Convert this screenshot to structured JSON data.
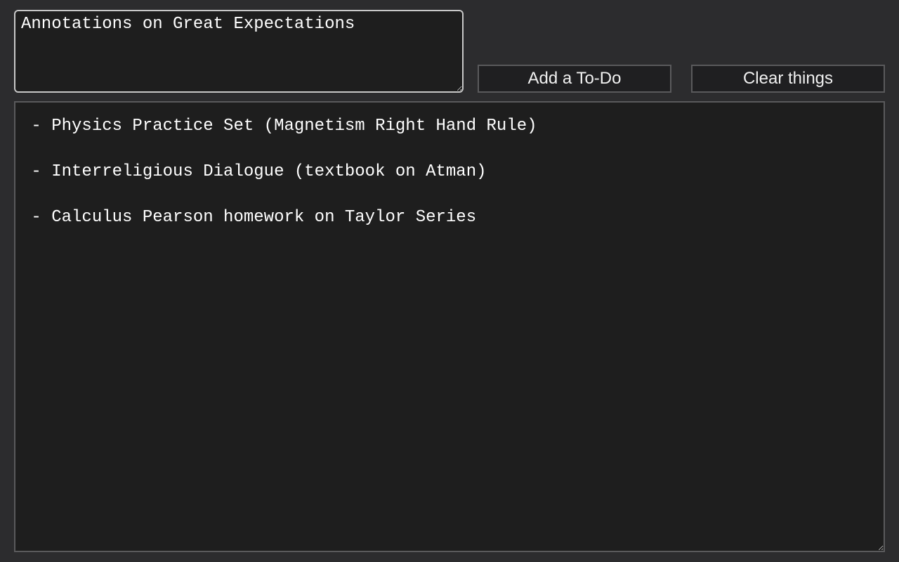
{
  "input": {
    "value": "Annotations on Great Expectations"
  },
  "buttons": {
    "add_label": "Add a To-Do",
    "clear_label": "Clear things"
  },
  "todo_list": {
    "content": " - Physics Practice Set (Magnetism Right Hand Rule)\n\n - Interreligious Dialogue (textbook on Atman)\n\n - Calculus Pearson homework on Taylor Series"
  }
}
